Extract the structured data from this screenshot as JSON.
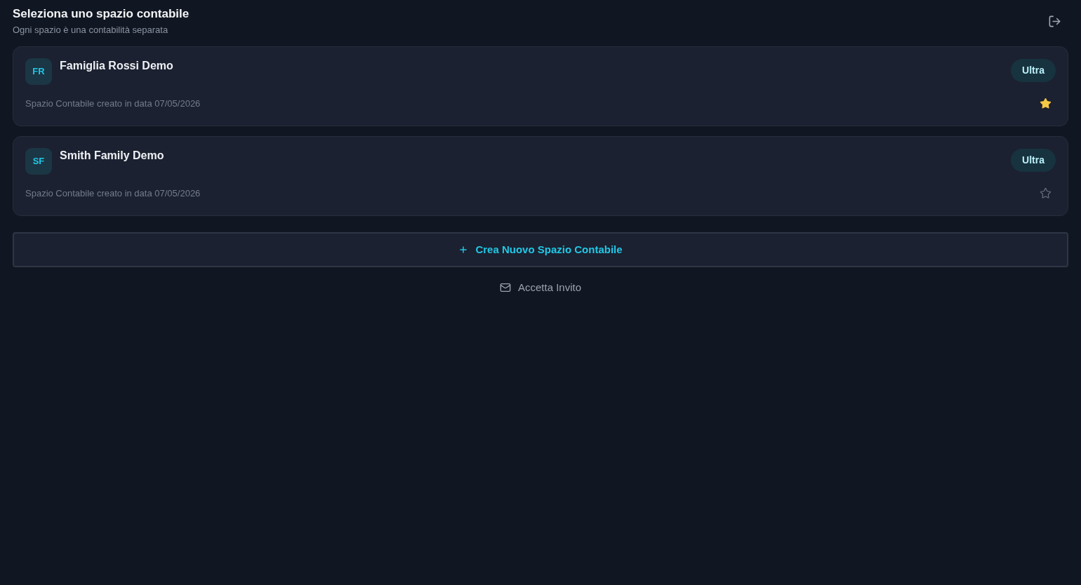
{
  "header": {
    "title": "Seleziona uno spazio contabile",
    "subtitle": "Ogni spazio è una contabilità separata"
  },
  "spaces": [
    {
      "initials": "FR",
      "name": "Famiglia Rossi Demo",
      "plan": "Ultra",
      "created": "Spazio Contabile creato in data 07/05/2026",
      "favorite": true
    },
    {
      "initials": "SF",
      "name": "Smith Family Demo",
      "plan": "Ultra",
      "created": "Spazio Contabile creato in data 07/05/2026",
      "favorite": false
    }
  ],
  "create_button": {
    "label": "Crea Nuovo Spazio Contabile"
  },
  "invite_link": {
    "label": "Accetta Invito"
  }
}
